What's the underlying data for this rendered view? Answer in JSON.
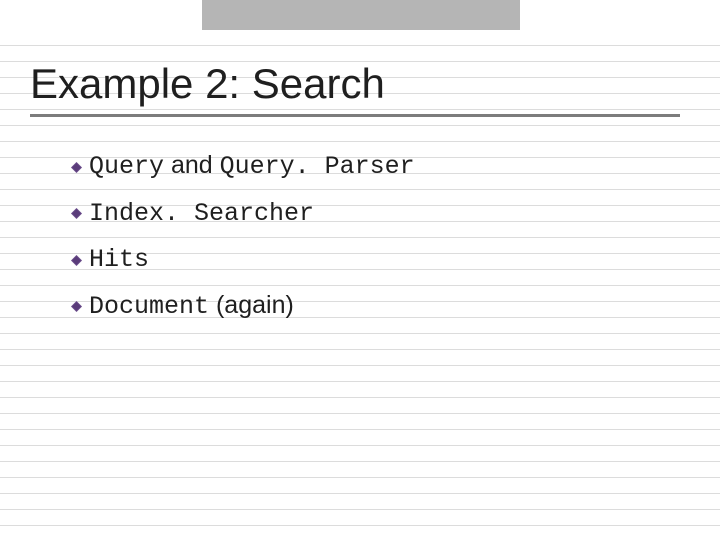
{
  "slide": {
    "title": "Example 2: Search",
    "bullets": [
      {
        "parts": [
          {
            "text": "Query",
            "mono": true
          },
          {
            "text": " and ",
            "mono": false
          },
          {
            "text": "Query. Parser",
            "mono": true
          }
        ]
      },
      {
        "parts": [
          {
            "text": "Index. Searcher",
            "mono": true
          }
        ]
      },
      {
        "parts": [
          {
            "text": "Hits",
            "mono": true
          }
        ]
      },
      {
        "parts": [
          {
            "text": "Document",
            "mono": true
          },
          {
            "text": " (again)",
            "mono": false
          }
        ]
      }
    ]
  },
  "style": {
    "bullet_fill": "#5a3c7a",
    "bullet_stroke": "#6a4c8a"
  }
}
